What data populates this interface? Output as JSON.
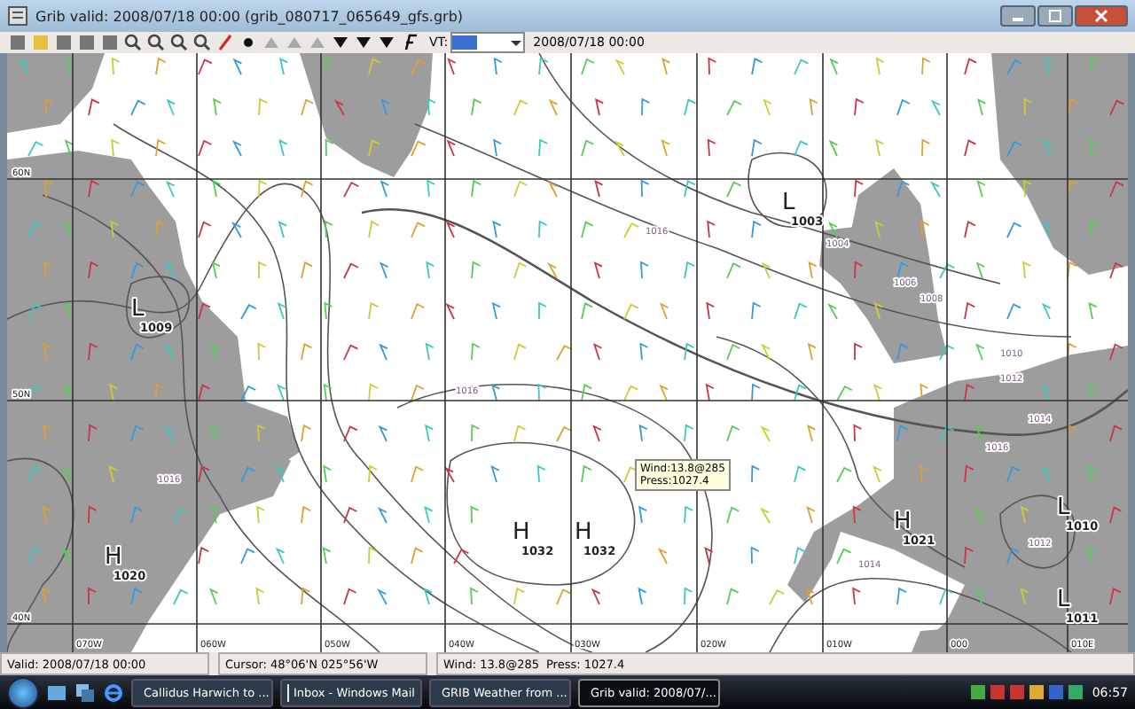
{
  "window": {
    "title": "Grib valid: 2008/07/18 00:00 (grib_080717_065649_gfs.grb)"
  },
  "toolbar": {
    "vt_label": "VT:",
    "vt_date": "2008/07/18 00:00"
  },
  "map": {
    "latitude_labels": [
      "60N",
      "50N",
      "40N"
    ],
    "longitude_labels": [
      "070W",
      "060W",
      "050W",
      "040W",
      "030W",
      "020W",
      "010W",
      "000",
      "010E"
    ],
    "pressure_centres": [
      {
        "letter": "L",
        "value": "1003"
      },
      {
        "letter": "L",
        "value": "1009"
      },
      {
        "letter": "H",
        "value": "1020"
      },
      {
        "letter": "H",
        "value": "1032"
      },
      {
        "letter": "H",
        "value": "1032"
      },
      {
        "letter": "H",
        "value": "1021"
      },
      {
        "letter": "L",
        "value": "1010"
      },
      {
        "letter": "L",
        "value": "1011"
      }
    ],
    "isobar_labels": [
      "1016",
      "1016",
      "1016",
      "1004",
      "1006",
      "1008",
      "1010",
      "1012",
      "1014",
      "1016",
      "1012",
      "1014"
    ],
    "tooltip": {
      "wind": "Wind:13.8@285",
      "pressure": "Press:1027.4"
    }
  },
  "status_bar": {
    "valid": "Valid: 2008/07/18 00:00",
    "cursor": "Cursor: 48°06'N  025°56'W",
    "wind": "Wind: 13.8@285",
    "pressure": "Press: 1027.4"
  },
  "taskbar": {
    "tasks": [
      {
        "label": "Callidus Harwich to ...",
        "selected": false
      },
      {
        "label": "Inbox - Windows Mail",
        "selected": false
      },
      {
        "label": "GRIB Weather from ...",
        "selected": false
      },
      {
        "label": "Grib valid: 2008/07/...",
        "selected": true
      }
    ],
    "clock": "06:57"
  }
}
